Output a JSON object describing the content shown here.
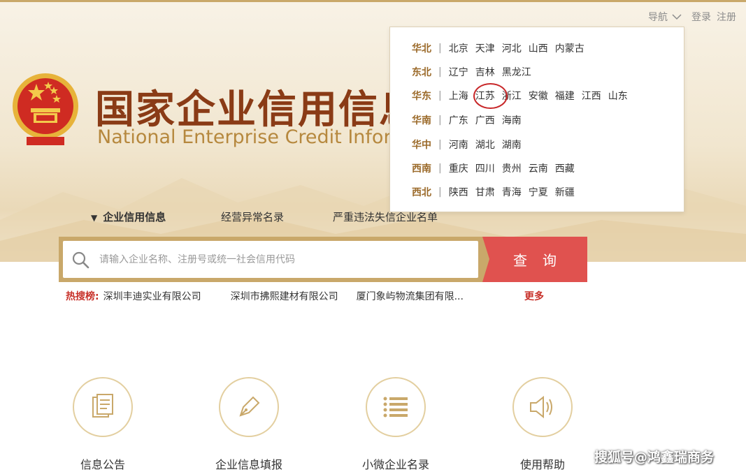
{
  "topbar": {
    "nav_label": "导航",
    "login": "登录",
    "register": "注册"
  },
  "header": {
    "title_cn": "国家企业信用信息公示系统",
    "title_en": "National Enterprise Credit Information Publicity System"
  },
  "tabs": [
    {
      "label": "企业信用信息",
      "active": true
    },
    {
      "label": "经营异常名录",
      "active": false
    },
    {
      "label": "严重违法失信企业名单",
      "active": false
    }
  ],
  "search": {
    "placeholder": "请输入企业名称、注册号或统一社会信用代码",
    "button_label": "查询"
  },
  "hot_search": {
    "label": "热搜榜:",
    "items": [
      "深圳丰迪实业有限公司",
      "深圳市拂熙建材有限公司",
      "厦门象屿物流集团有限..."
    ],
    "more": "更多"
  },
  "features": [
    {
      "label": "信息公告",
      "icon": "document-icon"
    },
    {
      "label": "企业信息填报",
      "icon": "pen-icon"
    },
    {
      "label": "小微企业名录",
      "icon": "list-icon"
    },
    {
      "label": "使用帮助",
      "icon": "speaker-icon"
    }
  ],
  "regions": [
    {
      "name": "华北",
      "provinces": [
        "北京",
        "天津",
        "河北",
        "山西",
        "内蒙古"
      ]
    },
    {
      "name": "东北",
      "provinces": [
        "辽宁",
        "吉林",
        "黑龙江"
      ]
    },
    {
      "name": "华东",
      "provinces": [
        "上海",
        "江苏",
        "浙江",
        "安徽",
        "福建",
        "江西",
        "山东"
      ]
    },
    {
      "name": "华南",
      "provinces": [
        "广东",
        "广西",
        "海南"
      ]
    },
    {
      "name": "华中",
      "provinces": [
        "河南",
        "湖北",
        "湖南"
      ]
    },
    {
      "name": "西南",
      "provinces": [
        "重庆",
        "四川",
        "贵州",
        "云南",
        "西藏"
      ]
    },
    {
      "name": "西北",
      "provinces": [
        "陕西",
        "甘肃",
        "青海",
        "宁夏",
        "新疆"
      ]
    }
  ],
  "highlighted_province": "江苏",
  "watermark": "搜狐号@鸿鑫瑞商务",
  "colors": {
    "brand_red": "#e0524f",
    "gold": "#c9a86a",
    "title_brown": "#8a3b16",
    "region_gold": "#9b6a2a"
  }
}
